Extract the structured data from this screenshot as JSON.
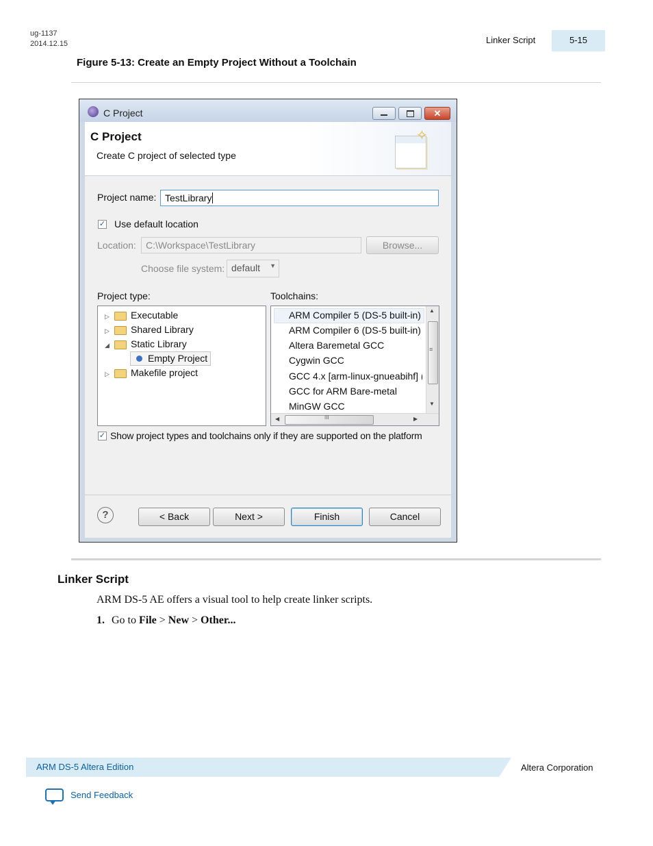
{
  "header": {
    "doc_id": "ug-1137",
    "date": "2014.12.15",
    "section": "Linker Script",
    "page": "5-15"
  },
  "figure": {
    "caption": "Figure 5-13: Create an Empty Project Without a Toolchain"
  },
  "dialog": {
    "window_title": "C Project",
    "heading": "C Project",
    "subheading": "Create C project of selected type",
    "project_name_label": "Project name:",
    "project_name_value": "TestLibrary",
    "use_default_location_label": "Use default location",
    "location_label": "Location:",
    "location_value": "C:\\Workspace\\TestLibrary",
    "browse_label": "Browse...",
    "file_system_label": "Choose file system:",
    "file_system_value": "default",
    "project_type_label": "Project type:",
    "toolchains_label": "Toolchains:",
    "project_types": [
      "Executable",
      "Shared Library",
      "Static Library",
      "Empty Project",
      "Makefile project"
    ],
    "toolchains": [
      "ARM Compiler 5 (DS-5 built-in)",
      "ARM Compiler 6 (DS-5 built-in)",
      "Altera Baremetal GCC",
      "Cygwin GCC",
      "GCC 4.x [arm-linux-gnueabihf] (",
      "GCC for ARM Bare-metal",
      "MinGW GCC"
    ],
    "show_supported_label": "Show project types and toolchains only if they are supported on the platform",
    "help_glyph": "?",
    "scroll_grip": "III",
    "buttons": {
      "back": "< Back",
      "next": "Next >",
      "finish": "Finish",
      "cancel": "Cancel"
    }
  },
  "section": {
    "title": "Linker Script",
    "intro": "ARM DS-5 AE offers a visual tool to help create linker scripts.",
    "step_number": "1.",
    "step_pre": "Go to ",
    "step_file": "File",
    "step_sep1": " > ",
    "step_new": "New",
    "step_sep2": " > ",
    "step_other": "Other..."
  },
  "footer": {
    "doc_title": "ARM DS-5 Altera Edition",
    "company": "Altera Corporation",
    "feedback": "Send Feedback"
  },
  "colors": {
    "accent_band": "#d9ecf6",
    "link": "#0b61a4"
  }
}
